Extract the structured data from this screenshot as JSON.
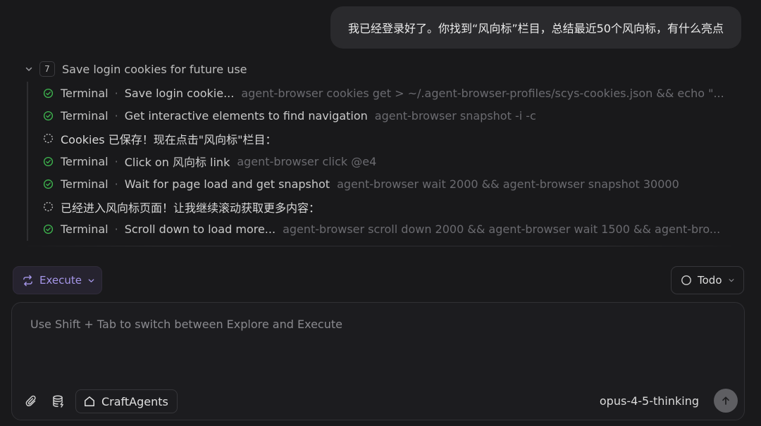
{
  "user_message": "我已经登录好了。你找到“风向标”栏目，总结最近50个风向标，有什么亮点",
  "step": {
    "number": "7",
    "title": "Save login cookies for future use",
    "rows": [
      {
        "type": "tool",
        "status": "done",
        "tool": "Terminal",
        "desc": "Save login cookie...",
        "cmd": "agent-browser cookies get > ~/.agent-browser-profiles/scys-cookies.json && echo \"..."
      },
      {
        "type": "tool",
        "status": "done",
        "tool": "Terminal",
        "desc": "Get interactive elements to find navigation",
        "cmd": "agent-browser snapshot -i -c"
      },
      {
        "type": "message",
        "status": "thinking",
        "text": "Cookies 已保存！现在点击\"风向标\"栏目："
      },
      {
        "type": "tool",
        "status": "done",
        "tool": "Terminal",
        "desc": "Click on 风向标 link",
        "cmd": "agent-browser click @e4"
      },
      {
        "type": "tool",
        "status": "done",
        "tool": "Terminal",
        "desc": "Wait for page load and get snapshot",
        "cmd": "agent-browser wait 2000 && agent-browser snapshot 30000"
      },
      {
        "type": "message",
        "status": "thinking",
        "text": "已经进入风向标页面！让我继续滚动获取更多内容："
      },
      {
        "type": "tool",
        "status": "done",
        "tool": "Terminal",
        "desc": "Scroll down to load more...",
        "cmd": "agent-browser scroll down 2000 && agent-browser wait 1500 && agent-bro..."
      }
    ],
    "separator": "·"
  },
  "toolbar": {
    "mode_label": "Execute",
    "todo_label": "Todo"
  },
  "composer": {
    "placeholder": "Use Shift + Tab to switch between Explore and Execute",
    "value": "",
    "workspace": "CraftAgents",
    "model": "opus-4-5-thinking"
  },
  "colors": {
    "background": "#19191b",
    "accent": "#a596e8",
    "success": "#3fb950"
  },
  "icons": {
    "done": "check-circle-icon",
    "thinking": "dashed-circle-icon",
    "mode": "repeat-icon",
    "attach": "paperclip-icon",
    "sources": "database-icon",
    "workspace": "home-icon",
    "send": "arrow-up-icon"
  }
}
